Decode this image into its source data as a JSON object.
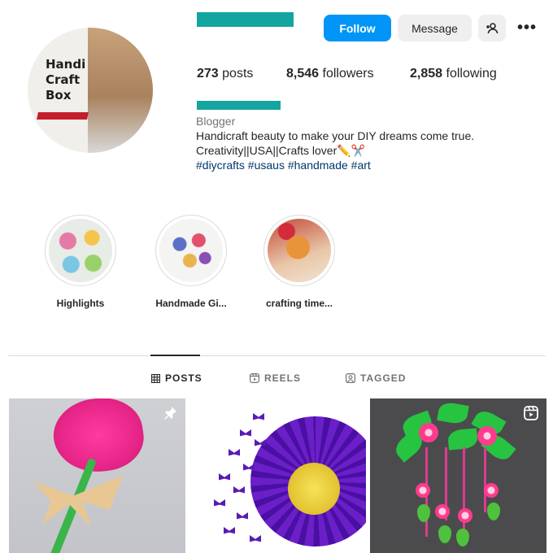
{
  "profile": {
    "avatar_text": "Handi Craft Box",
    "avatar_line1": "Handi",
    "avatar_line2": "Craft",
    "avatar_line3": "Box",
    "follow_label": "Follow",
    "message_label": "Message",
    "add_user_icon": "add-user-icon",
    "more_icon": "more-icon",
    "more_glyph": "•••",
    "stats": {
      "posts_count": "273",
      "posts_label": " posts",
      "followers_count": "8,546",
      "followers_label": " followers",
      "following_count": "2,858",
      "following_label": " following"
    },
    "category": "Blogger",
    "bio_line1": "Handicraft beauty to make your DIY dreams come true.",
    "bio_line2": "Creativity||USA||Crafts lover",
    "bio_emoji": "✏️✂️",
    "hashtags": "#diycrafts #usaus #handmade #art",
    "accent_color": "#0095f6",
    "redacted_color": "#14a5a0"
  },
  "highlights": [
    {
      "label": "Highlights"
    },
    {
      "label": "Handmade Gi..."
    },
    {
      "label": "crafting time..."
    }
  ],
  "tabs": [
    {
      "label": "POSTS",
      "icon": "grid-icon",
      "active": true
    },
    {
      "label": "REELS",
      "icon": "reels-icon",
      "active": false
    },
    {
      "label": "TAGGED",
      "icon": "tagged-icon",
      "active": false
    }
  ],
  "posts": [
    {
      "badge_icon": "pin-icon"
    },
    {
      "badge_icon": ""
    },
    {
      "badge_icon": "reel-icon"
    }
  ]
}
